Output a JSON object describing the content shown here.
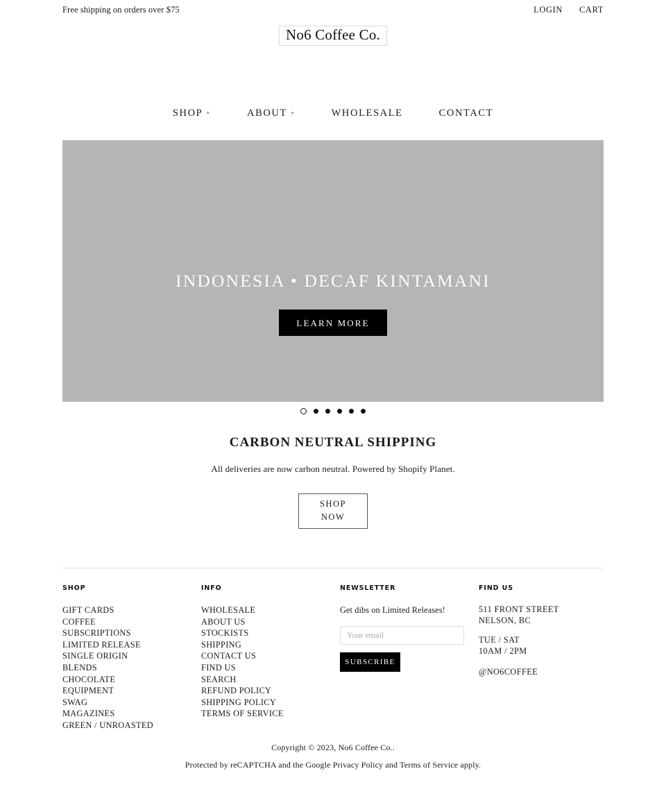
{
  "announcement": {
    "text": "Free shipping on orders over $75",
    "login_label": "LOGIN",
    "cart_label": "CART"
  },
  "logo": {
    "text": "No6 Coffee Co."
  },
  "nav": {
    "items": [
      {
        "label": "SHOP",
        "has_submenu": true,
        "marker": "+"
      },
      {
        "label": "ABOUT",
        "has_submenu": true,
        "marker": "+"
      },
      {
        "label": "WHOLESALE",
        "has_submenu": false,
        "marker": ""
      },
      {
        "label": "CONTACT",
        "has_submenu": false,
        "marker": ""
      }
    ]
  },
  "hero": {
    "title": "INDONESIA • DECAF KINTAMANI",
    "button_label": "LEARN MORE",
    "background_color": "#b5b5b5",
    "slides_total": 6,
    "active_slide": 1
  },
  "promo": {
    "title": "CARBON NEUTRAL SHIPPING",
    "subtitle": "All deliveries are now carbon neutral. Powered by Shopify Planet.",
    "button_line1": "SHOP",
    "button_line2": "NOW"
  },
  "footer": {
    "shop": {
      "heading": "SHOP",
      "links": [
        "GIFT CARDS",
        "COFFEE",
        "SUBSCRIPTIONS",
        "LIMITED RELEASE",
        "SINGLE ORIGIN",
        "BLENDS",
        "CHOCOLATE",
        "EQUIPMENT",
        "SWAG",
        "MAGAZINES",
        "GREEN / UNROASTED"
      ]
    },
    "info": {
      "heading": "INFO",
      "links": [
        "WHOLESALE",
        "ABOUT US",
        "STOCKISTS",
        "SHIPPING",
        "CONTACT US",
        "FIND US",
        "SEARCH",
        "REFUND POLICY",
        "SHIPPING POLICY",
        "TERMS OF SERVICE"
      ]
    },
    "newsletter": {
      "heading": "NEWSLETTER",
      "description": "Get dibs on Limited Releases!",
      "input_placeholder": "Your email",
      "input_value": "",
      "button_label": "SUBSCRIBE"
    },
    "find_us": {
      "heading": "FIND US",
      "address_line1": "511 FRONT STREET",
      "address_line2": "NELSON, BC",
      "hours_line1": "TUE / SAT",
      "hours_line2": "10AM / 2PM",
      "social_handle": "@NO6COFFEE"
    }
  },
  "bottom": {
    "copyright_prefix": "Copyright © 2023, ",
    "copyright_shop": "No6 Coffee Co.",
    "copyright_suffix": ".",
    "recaptcha_prefix": "Protected by reCAPTCHA and the Google ",
    "privacy_label": "Privacy Policy",
    "recaptcha_middle": " and ",
    "terms_label": "Terms of Service",
    "recaptcha_suffix": " apply."
  }
}
